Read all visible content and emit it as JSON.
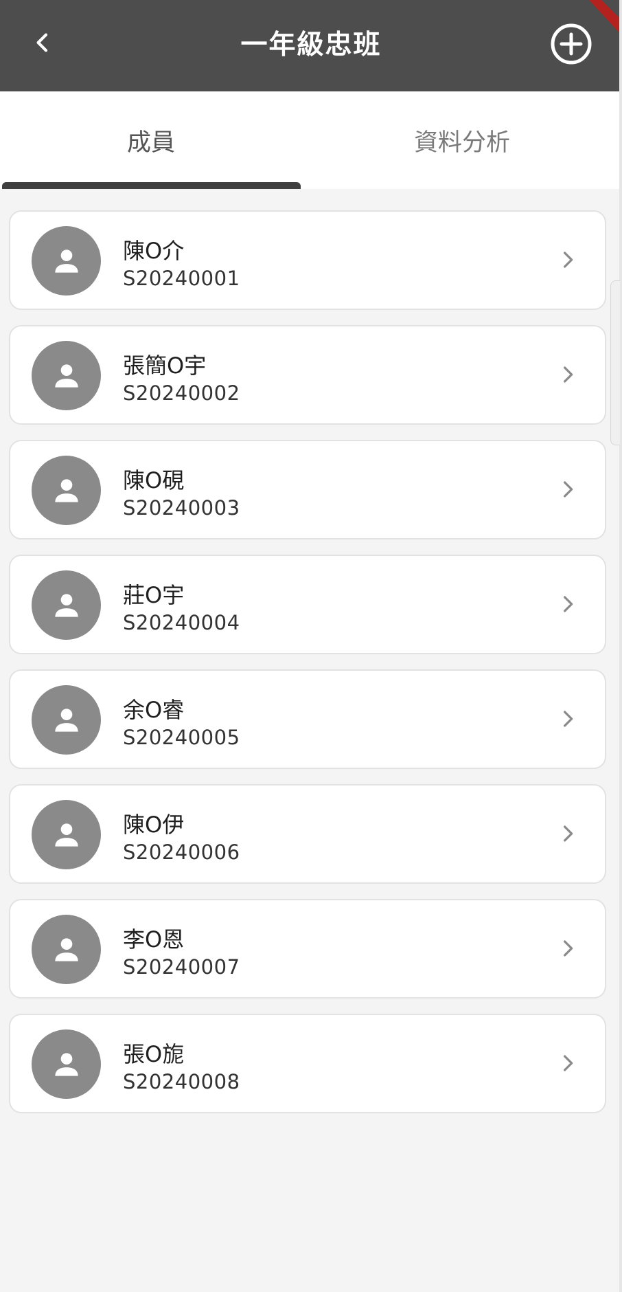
{
  "header": {
    "title": "一年級忠班",
    "back_icon": "chevron-left-icon",
    "add_icon": "plus-circle-icon"
  },
  "tabs": [
    {
      "label": "成員",
      "active": true
    },
    {
      "label": "資料分析",
      "active": false
    }
  ],
  "members": [
    {
      "name": "陳O介",
      "id": "S20240001"
    },
    {
      "name": "張簡O宇",
      "id": "S20240002"
    },
    {
      "name": "陳O硯",
      "id": "S20240003"
    },
    {
      "name": "莊O宇",
      "id": "S20240004"
    },
    {
      "name": "余O睿",
      "id": "S20240005"
    },
    {
      "name": "陳O伊",
      "id": "S20240006"
    },
    {
      "name": "李O恩",
      "id": "S20240007"
    },
    {
      "name": "張O旎",
      "id": "S20240008"
    }
  ],
  "colors": {
    "appbar": "#4d4d4d",
    "avatar": "#8a8a8a",
    "accent_ribbon": "#b3221e"
  }
}
